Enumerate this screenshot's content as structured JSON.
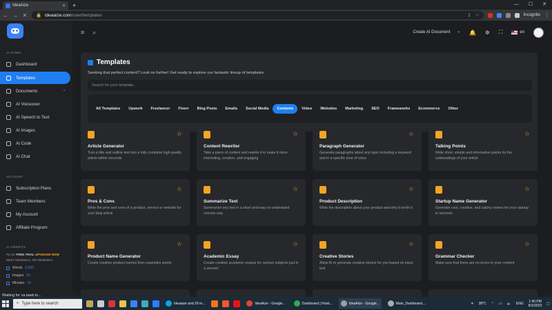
{
  "browser": {
    "tab_title": "IdeaAize",
    "url_host": "ideaaize.com",
    "url_path": "/user/templates",
    "profile": "Incognito"
  },
  "sidebar": {
    "section_ai": "AI PANEL",
    "ai_items": [
      {
        "label": "Dashboard",
        "icon": "dashboard-icon"
      },
      {
        "label": "Templates",
        "icon": "templates-icon",
        "active": true
      },
      {
        "label": "Documents",
        "icon": "documents-icon",
        "has_chevron": true
      },
      {
        "label": "AI Voiceover",
        "icon": "voiceover-icon"
      },
      {
        "label": "AI Speech to Text",
        "icon": "speech-icon"
      },
      {
        "label": "AI Images",
        "icon": "images-icon"
      },
      {
        "label": "AI Code",
        "icon": "code-icon"
      },
      {
        "label": "AI Chat",
        "icon": "chat-icon"
      }
    ],
    "section_account": "ACCOUNT",
    "account_items": [
      {
        "label": "Subscription Plans",
        "icon": "subscription-icon"
      },
      {
        "label": "Team Members",
        "icon": "team-icon"
      },
      {
        "label": "My Account",
        "icon": "account-icon"
      },
      {
        "label": "Affiliate Program",
        "icon": "affiliate-icon"
      }
    ],
    "section_credits": "AI CREDITS",
    "plan_label": "PLAN:",
    "plan_value": "FREE TRIAL",
    "upgrade_label": "UPGRADE NOW",
    "renewal_label": "NEXT RENEWAL: NO RENEWAL",
    "credits": [
      {
        "label": "Words",
        "value": "5,000"
      },
      {
        "label": "Images",
        "value": "50"
      },
      {
        "label": "Minutes",
        "value": "10"
      }
    ]
  },
  "topbar": {
    "create_label": "Create AI Document",
    "lang": "en"
  },
  "templates": {
    "title": "Templates",
    "subtitle": "Seeking that perfect content? Look no further! Get ready to explore our fantastic lineup of templates",
    "search_placeholder": "Search for your template...",
    "filters": [
      "All Templates",
      "Upwork",
      "Freelancer",
      "Fiverr",
      "Blog Posts",
      "Emails",
      "Social Media",
      "Contents",
      "Video",
      "Websites",
      "Marketing",
      "SEO",
      "Frameworks",
      "Ecommerce",
      "Other"
    ],
    "selected_filter": "Contents",
    "cards": [
      {
        "title": "Article Generator",
        "desc": "Turn a title and outline text into a fully complete high quality article within seconds"
      },
      {
        "title": "Content Rewriter",
        "desc": "Take a piece of content and rewrite it to make it more interesting, creative, and engaging"
      },
      {
        "title": "Paragraph Generator",
        "desc": "Generate paragraphs about any topic including a keyword and in a specific tone of voice"
      },
      {
        "title": "Talking Points",
        "desc": "Write short, simple and informative points for the subheadings of your article"
      },
      {
        "title": "Pros & Cons",
        "desc": "Write the pros and cons of a product, service or website for your blog article"
      },
      {
        "title": "Summarize Text",
        "desc": "Summarize any text in a short and easy to understand concise way"
      },
      {
        "title": "Product Description",
        "desc": "Write the description about your product and why it worth it"
      },
      {
        "title": "Startup Name Generator",
        "desc": "Generate cool, creative, and catchy names for your startup in seconds"
      },
      {
        "title": "Product Name Generator",
        "desc": "Create creative product names from examples words"
      },
      {
        "title": "Academic Essay",
        "desc": "Create creative academic essays for various subjects just in a second"
      },
      {
        "title": "Creative Stories",
        "desc": "Allow AI to generate creative stories for you based on input text"
      },
      {
        "title": "Grammar Checker",
        "desc": "Make sure that there are no errors in your content"
      }
    ]
  },
  "status_text": "Waiting for va.tawk.to...",
  "taskbar": {
    "search_text": "Type here to search",
    "items": [
      "Ideaaize and 29 m...",
      "IdeaAize - Google...",
      "Dashboard | Hosti...",
      "IdeaAize - Google...",
      "Main_Dashboard...."
    ],
    "weather": "38°C",
    "lang": "ENG",
    "time": "1:40 PM",
    "date": "8/1/2023"
  }
}
